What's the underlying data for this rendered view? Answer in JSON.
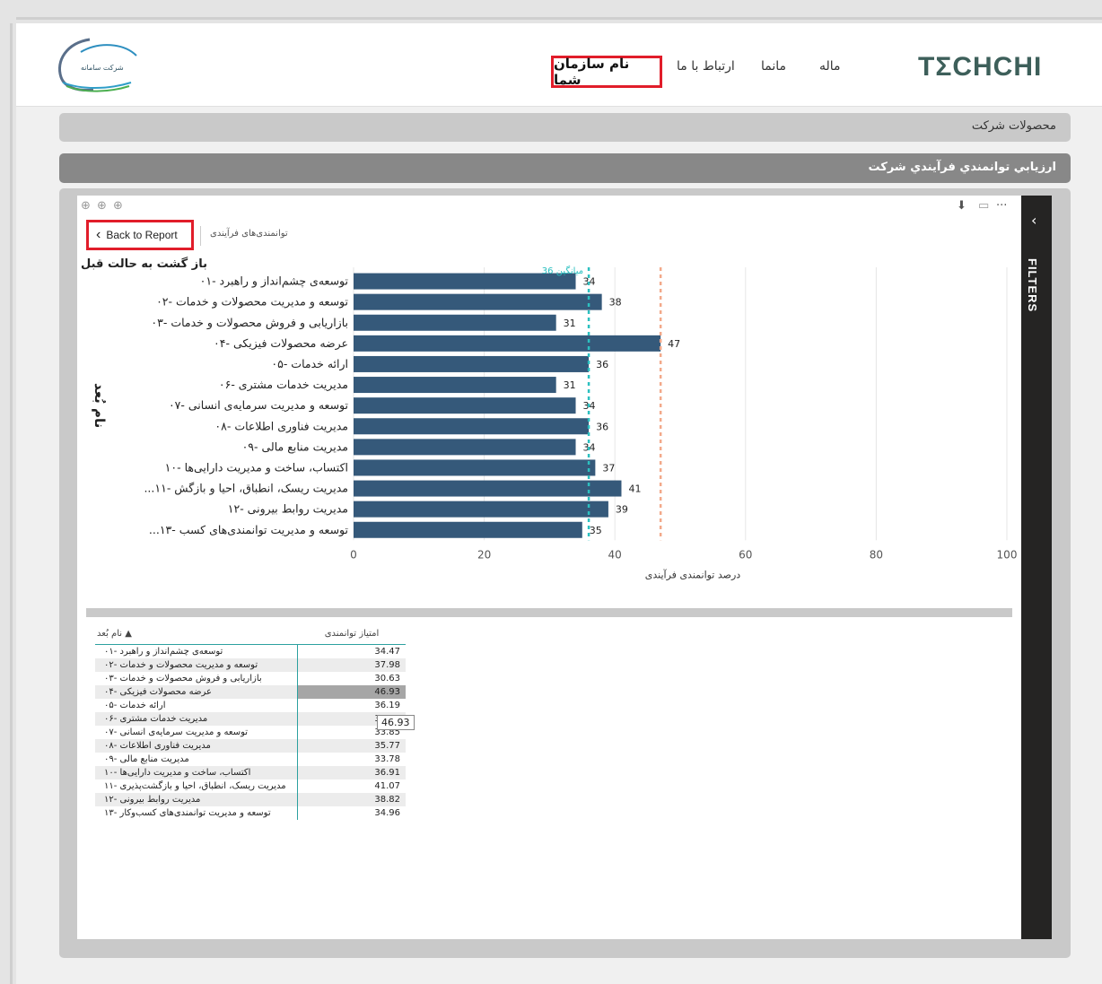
{
  "header": {
    "brand": "TΣCHCHI",
    "nav_primary": "نام سازمان شما",
    "nav_items": [
      "ارتباط با ما",
      "مانما",
      "ماله"
    ]
  },
  "sections": {
    "products": "محصولات شرکت",
    "assessment": "ارزيابي توانمندي فرآيندي شرکت"
  },
  "report": {
    "back_button": "Back to Report",
    "breadcrumb": "توانمندی‌های فرآیندی",
    "back_caption": "باز گشت به حالت قبل",
    "filters_label": "FILTERS",
    "avg_label": "میانگین 36"
  },
  "chart_data": {
    "type": "bar",
    "orientation": "horizontal",
    "xlabel": "درصد توانمندی فرآیندی",
    "ylabel": "نام بُعد",
    "xlim": [
      0,
      100
    ],
    "xticks": [
      0,
      20,
      40,
      60,
      80,
      100
    ],
    "categories": [
      "توسعه‌ی چشم‌انداز و راهبرد -۰۱",
      "توسعه و مدیریت محصولات و خدمات -۰۲",
      "بازاریابی و فروش محصولات و خدمات -۰۳",
      "عرضه محصولات فیزیکی -۰۴",
      "ارائه خدمات -۰۵",
      "مدیریت خدمات مشتری -۰۶",
      "توسعه و مدیریت سرمایه‌ی انسانی -۰۷",
      "مدیریت فناوری اطلاعات -۰۸",
      "مدیریت منابع مالی -۰۹",
      "اکتساب، ساخت و مدیریت دارایی‌ها -۱۰",
      "...مدیریت ریسک، انطباق، احیا و بازگش -۱۱",
      "مدیریت روابط بیرونی -۱۲",
      "...توسعه و مدیریت توانمندی‌های کسب -۱۳"
    ],
    "values": [
      34,
      38,
      31,
      47,
      36,
      31,
      34,
      36,
      34,
      37,
      41,
      39,
      35
    ],
    "reference_lines": [
      {
        "value": 36,
        "color": "#2cc0c0",
        "style": "dashed",
        "label": "میانگین 36"
      },
      {
        "value": 47,
        "color": "#f2a98a",
        "style": "dashed"
      }
    ],
    "bar_color": "#35597a",
    "grid": true
  },
  "table": {
    "headers": [
      "نام بُعد",
      "امتیاز توانمندی"
    ],
    "rows": [
      [
        "توسعه‌ی چشم‌انداز و راهبرد -۰۱",
        "34.47"
      ],
      [
        "توسعه و مدیریت محصولات و خدمات -۰۲",
        "37.98"
      ],
      [
        "بازاریابی و فروش محصولات و خدمات -۰۳",
        "30.63"
      ],
      [
        "عرضه محصولات فیزیکی -۰۴",
        "46.93"
      ],
      [
        "ارائه خدمات -۰۵",
        "36.19"
      ],
      [
        "مدیریت خدمات مشتری -۰۶",
        "30.85"
      ],
      [
        "توسعه و مدیریت سرمایه‌ی انسانی -۰۷",
        "33.85"
      ],
      [
        "مدیریت فناوری اطلاعات -۰۸",
        "35.77"
      ],
      [
        "مدیریت منابع مالی -۰۹",
        "33.78"
      ],
      [
        "اکتساب، ساخت و مدیریت دارایی‌ها -۱۰",
        "36.91"
      ],
      [
        "مدیریت ریسک، انطباق، احیا و بازگشت‌پذیری -۱۱",
        "41.07"
      ],
      [
        "مدیریت روابط بیرونی -۱۲",
        "38.82"
      ],
      [
        "توسعه و مدیریت توانمندی‌های کسب‌وکار -۱۳",
        "34.96"
      ]
    ],
    "tooltip": "46.93"
  }
}
